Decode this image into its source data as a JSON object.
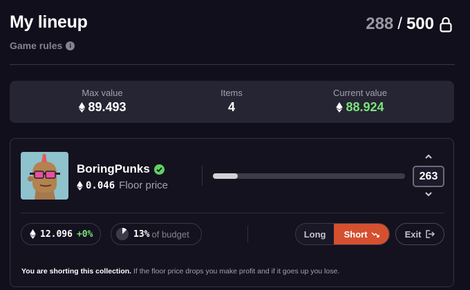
{
  "header": {
    "title": "My lineup",
    "game_rules_label": "Game rules",
    "used": "288",
    "separator": "/",
    "total": "500"
  },
  "stats": {
    "max_value": {
      "label": "Max value",
      "value": "89.493"
    },
    "items": {
      "label": "Items",
      "value": "4"
    },
    "current_value": {
      "label": "Current value",
      "value": "88.924"
    }
  },
  "card": {
    "collection_name": "BoringPunks",
    "floor_value": "0.046",
    "floor_label": "Floor price",
    "slider_fraction": 0.13,
    "amount": "263",
    "position_value": "12.096",
    "change": "+0%",
    "budget_percent": "13%",
    "budget_label": "of budget",
    "long_label": "Long",
    "short_label": "Short",
    "exit_label": "Exit",
    "note_bold": "You are shorting this collection.",
    "note_text": " If the floor price drops you make profit and if it goes up you lose."
  },
  "colors": {
    "background": "#110f1c",
    "panel": "#262533",
    "green": "#7ae37a",
    "short_active": "#d5502f"
  }
}
